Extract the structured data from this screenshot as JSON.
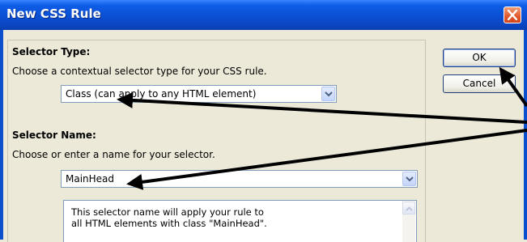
{
  "window": {
    "title": "New CSS Rule"
  },
  "selector_type": {
    "heading": "Selector Type:",
    "description": "Choose a contextual selector type for your CSS rule.",
    "value": "Class (can apply to any HTML element)"
  },
  "selector_name": {
    "heading": "Selector Name:",
    "description": "Choose or enter a name for your selector.",
    "value": "MainHead",
    "info_line1": "This selector name will apply your rule to",
    "info_line2": "all HTML elements with class \"MainHead\"."
  },
  "buttons": {
    "ok": "OK",
    "cancel": "Cancel"
  },
  "icons": {
    "close": "close-icon",
    "dropdown": "chevron-down-icon",
    "scroll_up": "chevron-up-icon",
    "annotation": "arrow-annotation"
  },
  "colors": {
    "titlebar": "#0a4fd3",
    "close": "#e2572b",
    "dialog_bg": "#ece9d8"
  }
}
